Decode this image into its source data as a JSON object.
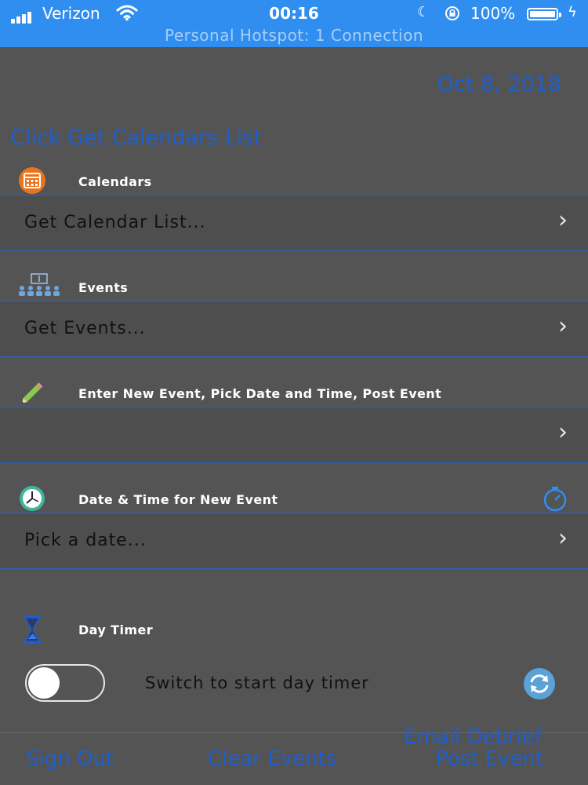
{
  "status_bar": {
    "carrier": "Verizon",
    "time": "00:16",
    "battery": "100%",
    "hotspot": "Personal Hotspot: 1 Connection",
    "icons": [
      "signal-icon",
      "wifi-icon",
      "moon-icon",
      "rotation-lock-icon",
      "battery-icon",
      "charging-icon"
    ],
    "background_color": "#2f8ef0"
  },
  "header": {
    "date": "Oct 8, 2018",
    "hint": "Click Get Calendars List"
  },
  "sections": {
    "calendars": {
      "header": "Calendars",
      "row_text": "Get Calendar List...",
      "icon": "calendar-icon"
    },
    "events": {
      "header": "Events",
      "row_text": "Get Events...",
      "icon": "events-people-icon"
    },
    "new_event": {
      "header": "Enter New Event, Pick Date and Time, Post Event",
      "row_text": "",
      "icon": "pencil-icon"
    },
    "date_time": {
      "header": "Date & Time for New Event",
      "row_text": "Pick a date...",
      "icon": "clock-icon",
      "action_icon": "stopwatch-icon"
    },
    "day_timer": {
      "header": "Day Timer",
      "switch_label": "Switch to start day timer",
      "switch_on": false,
      "icon": "hourglass-icon",
      "action_icon": "refresh-icon"
    }
  },
  "footer": {
    "sign_out": "Sign Out",
    "clear_events": "Clear Events",
    "email_debrief": "Email Debrief",
    "post_event": "Post Event"
  },
  "colors": {
    "background": "#545454",
    "accent_text": "#1d5fd0",
    "row_border": "#2c63c4"
  }
}
